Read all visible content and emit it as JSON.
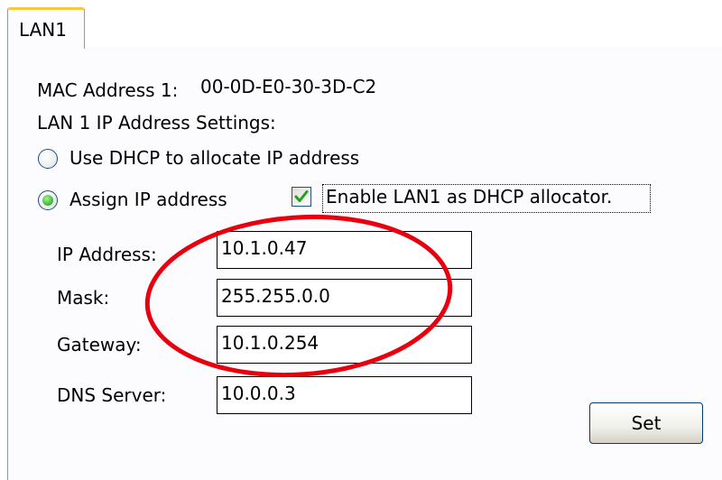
{
  "tab": {
    "label": "LAN1"
  },
  "mac": {
    "label": "MAC Address 1:",
    "value": "00-0D-E0-30-3D-C2"
  },
  "settings_label": "LAN 1 IP Address Settings:",
  "options": {
    "dhcp_label": "Use DHCP to allocate IP address",
    "dhcp_selected": false,
    "assign_label": "Assign IP address",
    "assign_selected": true,
    "enable_dhcp_allocator_label": "Enable LAN1 as DHCP allocator.",
    "enable_dhcp_allocator_checked": true
  },
  "fields": {
    "ip": {
      "label": "IP Address:",
      "value": "10.1.0.47"
    },
    "mask": {
      "label": "Mask:",
      "value": "255.255.0.0"
    },
    "gateway": {
      "label": "Gateway:",
      "value": "10.1.0.254"
    },
    "dns": {
      "label": "DNS Server:",
      "value": "10.0.0.3"
    }
  },
  "buttons": {
    "set_label": "Set"
  },
  "colors": {
    "annotation_ellipse": "#e8000e",
    "radio_selected": "#31b530",
    "checkmark": "#21a121",
    "tab_highlight": "#ffc83c"
  }
}
